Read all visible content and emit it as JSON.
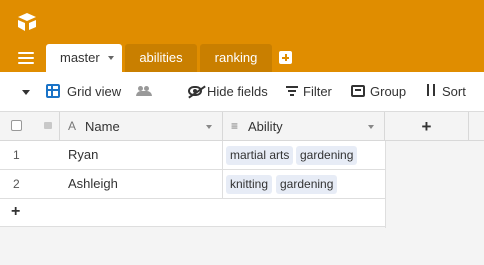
{
  "topbar": {
    "bg_color": "#e08d00",
    "logo_icon": "airtable-logo",
    "menu_icon": "hamburger-menu-icon",
    "tabs": [
      {
        "label": "master",
        "active": true
      },
      {
        "label": "abilities",
        "active": false
      },
      {
        "label": "ranking",
        "active": false
      }
    ],
    "add_tab_icon": "plus-square-icon"
  },
  "toolbar": {
    "view_name": "Grid view",
    "hide_fields": "Hide fields",
    "filter": "Filter",
    "group": "Group",
    "sort": "Sort"
  },
  "grid": {
    "columns": [
      {
        "label": "Name",
        "icon": "A"
      },
      {
        "label": "Ability",
        "icon": "≡"
      }
    ],
    "add_column": "+",
    "rows": [
      {
        "num": "1",
        "name": "Ryan",
        "abilities": [
          "martial arts",
          "gardening"
        ]
      },
      {
        "num": "2",
        "name": "Ashleigh",
        "abilities": [
          "knitting",
          "gardening"
        ]
      }
    ],
    "add_row": "+"
  }
}
